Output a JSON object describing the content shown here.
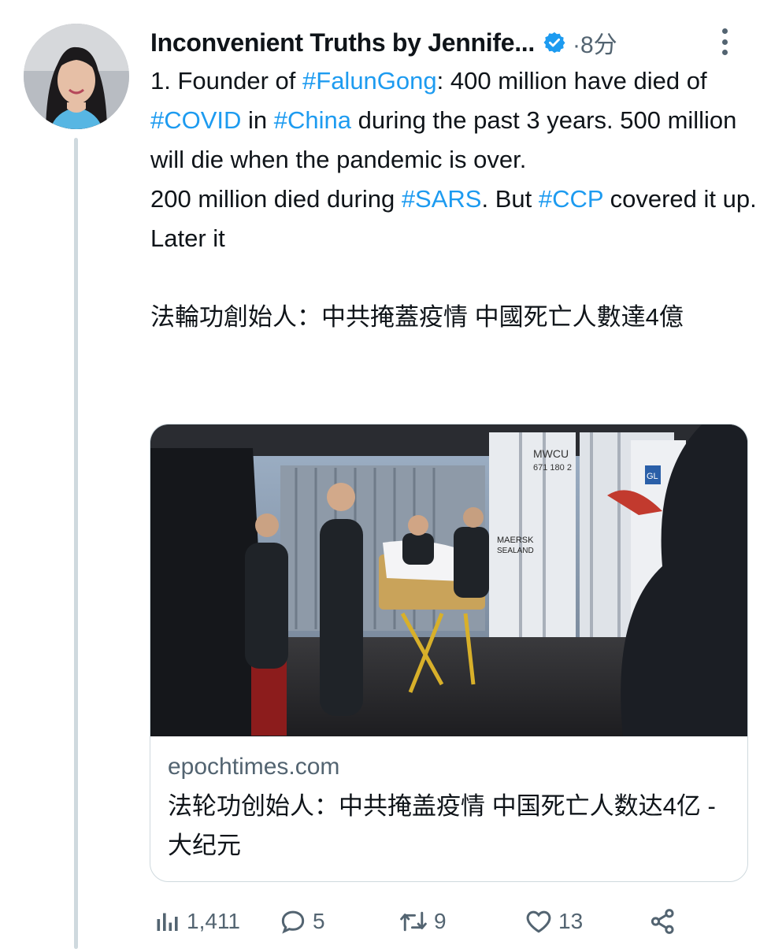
{
  "tweet": {
    "author_name": "Inconvenient Truths by Jennife...",
    "timestamp": "·8分",
    "text_segments": [
      {
        "t": "1. Founder of ",
        "ht": false
      },
      {
        "t": "#FalunGong",
        "ht": true
      },
      {
        "t": ": 400 million have died of ",
        "ht": false
      },
      {
        "t": "#COVID",
        "ht": true
      },
      {
        "t": " in ",
        "ht": false
      },
      {
        "t": "#China",
        "ht": true
      },
      {
        "t": " during the past 3 years. 500 million will die when the pandemic is over.",
        "ht": false
      }
    ],
    "text_line2_segments": [
      {
        "t": "200 million died during ",
        "ht": false
      },
      {
        "t": "#SARS",
        "ht": true
      },
      {
        "t": ". But ",
        "ht": false
      },
      {
        "t": "#CCP",
        "ht": true
      },
      {
        "t": " covered it up. Later it",
        "ht": false
      }
    ],
    "chinese_text": "法輪功創始人：中共掩蓋疫情 中國死亡人數達4億"
  },
  "card": {
    "domain": "epochtimes.com",
    "title": "法轮功创始人：中共掩盖疫情 中国死亡人数达4亿 - 大纪元",
    "image_text_1": "MWCU",
    "image_text_2": "671 180 2",
    "image_text_3": "MAERSK",
    "image_text_4": "SEALAND",
    "image_text_5": "GL"
  },
  "actions": {
    "views": "1,411",
    "replies": "5",
    "retweets": "9",
    "likes": "13"
  },
  "colors": {
    "accent": "#1d9bf0",
    "text": "#0f1419",
    "muted": "#536471",
    "border": "#cfd9de"
  },
  "icons": [
    "verified-icon",
    "more-icon",
    "views-icon",
    "reply-icon",
    "retweet-icon",
    "like-icon",
    "share-icon"
  ]
}
